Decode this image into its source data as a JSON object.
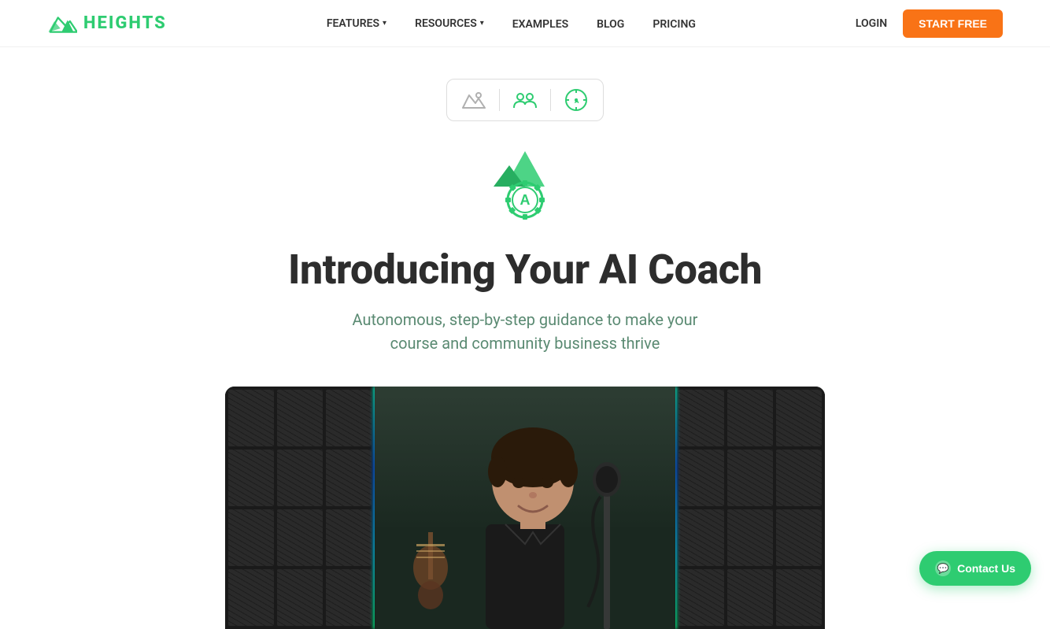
{
  "nav": {
    "logo_text": "HEIGHTS",
    "links": [
      {
        "label": "FEATURES",
        "has_dropdown": true
      },
      {
        "label": "RESOURCES",
        "has_dropdown": true
      },
      {
        "label": "EXAMPLES",
        "has_dropdown": false
      },
      {
        "label": "BLOG",
        "has_dropdown": false
      },
      {
        "label": "PRICING",
        "has_dropdown": false
      }
    ],
    "login_label": "LOGIN",
    "start_free_label": "START FREE"
  },
  "hero": {
    "title": "Introducing Your AI Coach",
    "subtitle_line1": "Autonomous, step-by-step guidance to make your",
    "subtitle_line2": "course and community business thrive"
  },
  "contact_btn": {
    "label": "Contact Us"
  }
}
